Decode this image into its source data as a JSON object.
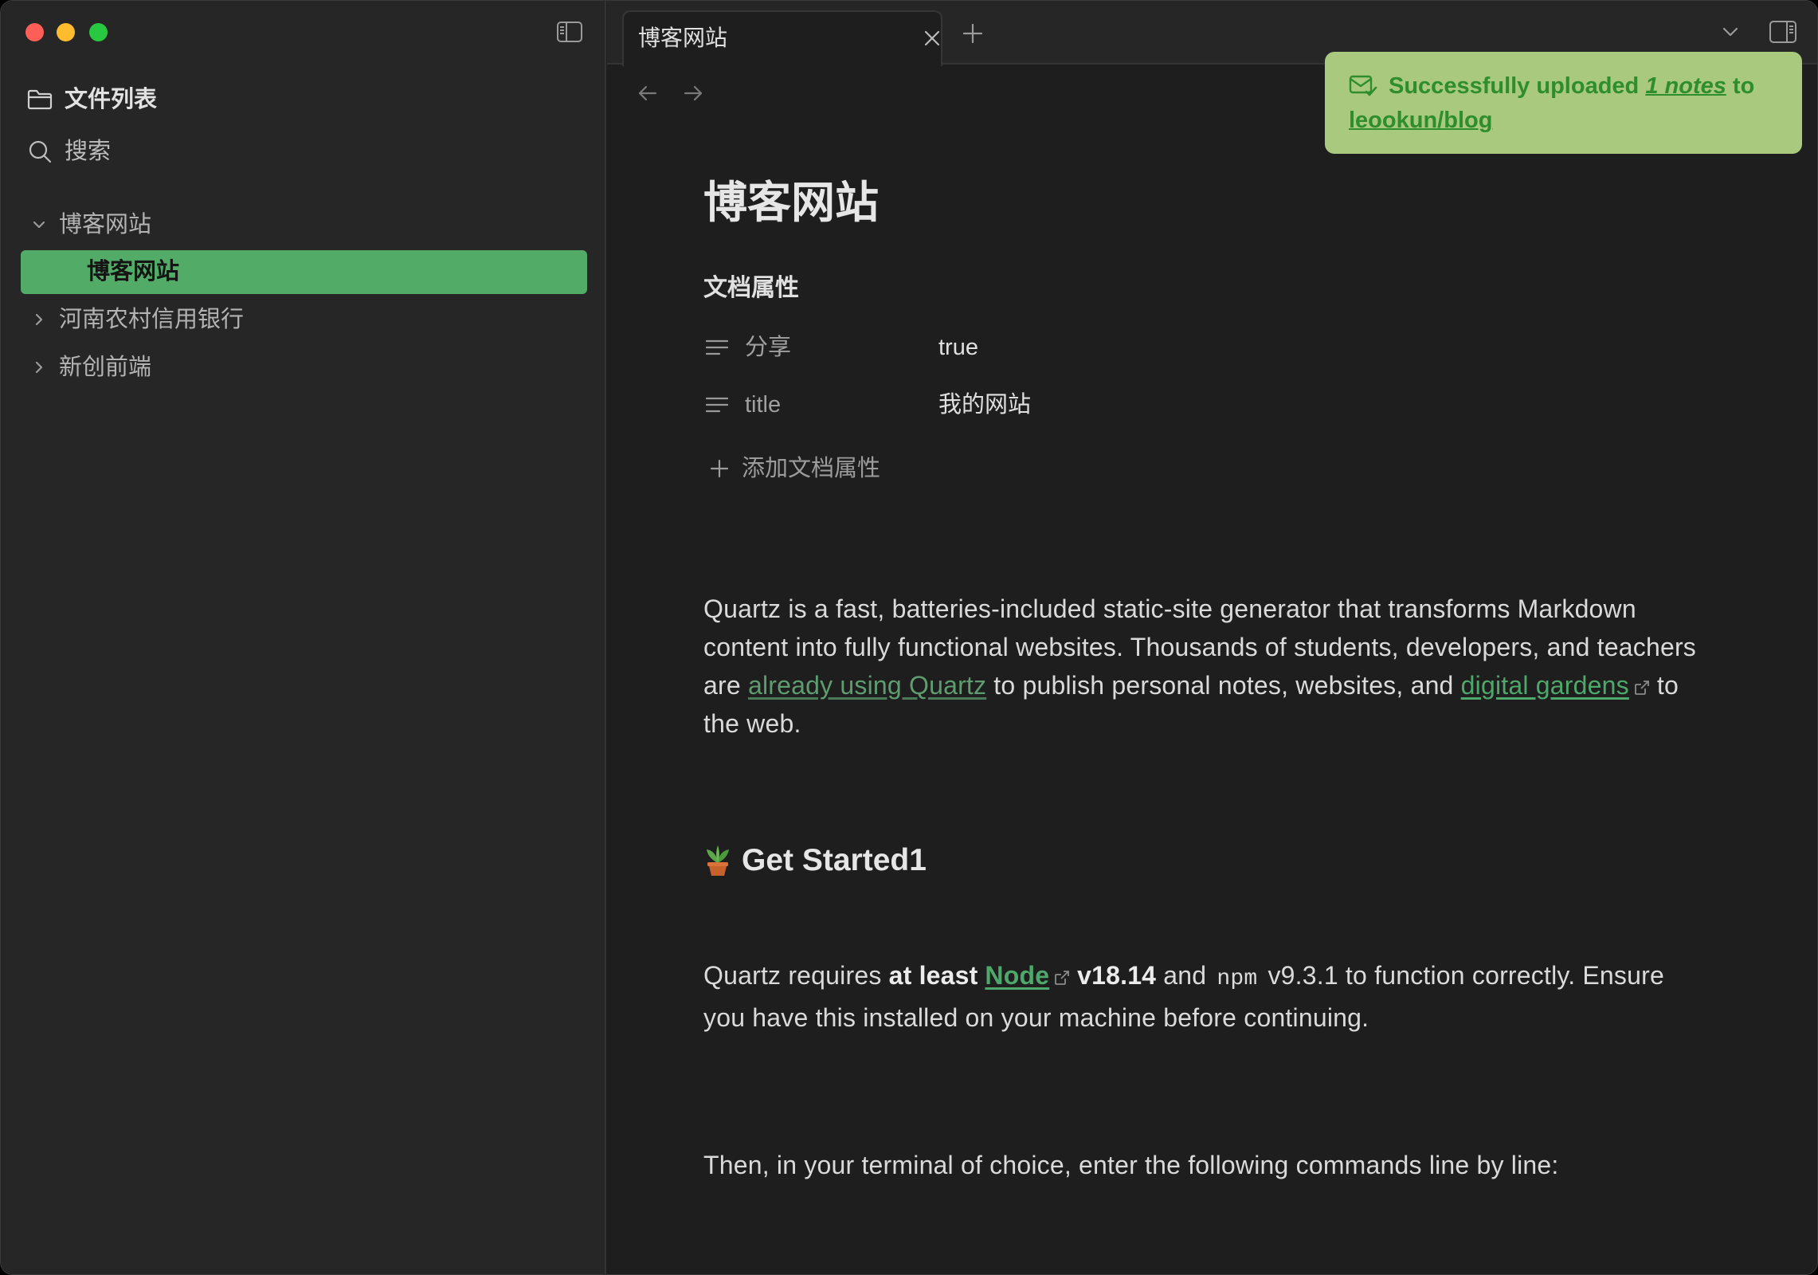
{
  "colors": {
    "background": "#1e1e1e",
    "sidebar_background": "#262626",
    "accent": "#52ab67",
    "link": "#4fa86b",
    "internal_link": "#5f9c70",
    "toast_background": "#a8c97e",
    "toast_text": "#2e8e2e",
    "traffic_close": "#ff5f57",
    "traffic_minimize": "#febc2e",
    "traffic_zoom": "#28c840"
  },
  "window_controls": [
    "close",
    "minimize",
    "zoom"
  ],
  "sidebar": {
    "toggle_icon": "sidebar-left-icon",
    "files": {
      "icon": "folder-icon",
      "label": "文件列表"
    },
    "search": {
      "icon": "search-icon",
      "label": "搜索"
    },
    "tree": [
      {
        "label": "博客网站",
        "expanded": true,
        "children": [
          {
            "label": "博客网站",
            "active": true
          }
        ]
      },
      {
        "label": "河南农村信用银行",
        "expanded": false
      },
      {
        "label": "新创前端",
        "expanded": false
      }
    ]
  },
  "tabs": {
    "items": [
      {
        "label": "博客网站",
        "active": true,
        "close_icon": "close-icon"
      }
    ],
    "new_tab_icon": "plus-icon",
    "tab_list_icon": "chevron-down-icon",
    "right_sidebar_icon": "sidebar-right-icon"
  },
  "navigation": {
    "back_icon": "arrow-left-icon",
    "forward_icon": "arrow-right-icon"
  },
  "toast": {
    "icon": "mail-check-icon",
    "text_before": "Successfully uploaded ",
    "count_link": "1 notes",
    "text_middle": " to ",
    "repo_link": "leookun/blog"
  },
  "note": {
    "title": "博客网站",
    "properties": {
      "heading": "文档属性",
      "items": [
        {
          "icon": "text-lines-icon",
          "key": "分享",
          "value": "true"
        },
        {
          "icon": "text-lines-icon",
          "key": "title",
          "value": "我的网站"
        }
      ],
      "add_icon": "plus-icon",
      "add_label": "添加文档属性"
    },
    "intro": {
      "text_1": "Quartz is a fast, batteries-included static-site generator that transforms Markdown content into fully functional websites. Thousands of students, developers, and teachers are ",
      "internal_link": "already using Quartz",
      "text_2": " to publish personal notes, websites, and ",
      "external_link": "digital gardens",
      "text_3": " to the web."
    },
    "get_started": {
      "icon": "potted-plant-icon",
      "heading": "Get Started1"
    },
    "requirements": {
      "text_before": "Quartz requires ",
      "bold_1": "at least",
      "node_link": "Node",
      "bold_version": "v18.14",
      "text_and": " and ",
      "code": "npm",
      "text_after": " v9.3.1 to function correctly. Ensure you have this installed on your machine before continuing."
    },
    "terminal": {
      "text": "Then, in your terminal of choice, enter the following commands line by line:"
    }
  }
}
